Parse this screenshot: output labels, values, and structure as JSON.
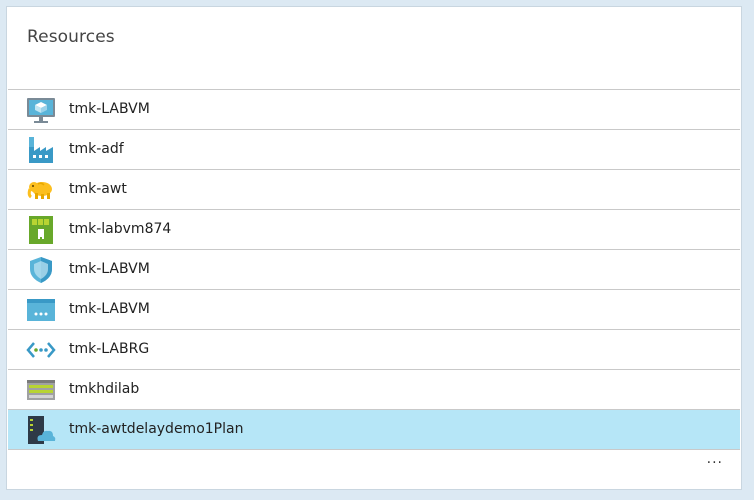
{
  "blade": {
    "title": "Resources",
    "more_label": "...",
    "accent_color": "#b6e6f7"
  },
  "resources": [
    {
      "name": "tmk-LABVM",
      "icon": "virtual-machine-icon"
    },
    {
      "name": "tmk-adf",
      "icon": "data-factory-icon"
    },
    {
      "name": "tmk-awt",
      "icon": "hdinsight-elephant-icon"
    },
    {
      "name": "tmk-labvm874",
      "icon": "network-interface-icon"
    },
    {
      "name": "tmk-LABVM",
      "icon": "network-security-group-icon"
    },
    {
      "name": "tmk-LABVM",
      "icon": "public-ip-icon"
    },
    {
      "name": "tmk-LABRG",
      "icon": "virtual-network-icon"
    },
    {
      "name": "tmkhdilab",
      "icon": "storage-account-icon"
    },
    {
      "name": "tmk-awtdelaydemo1Plan",
      "icon": "app-service-plan-icon",
      "selected": true
    }
  ]
}
